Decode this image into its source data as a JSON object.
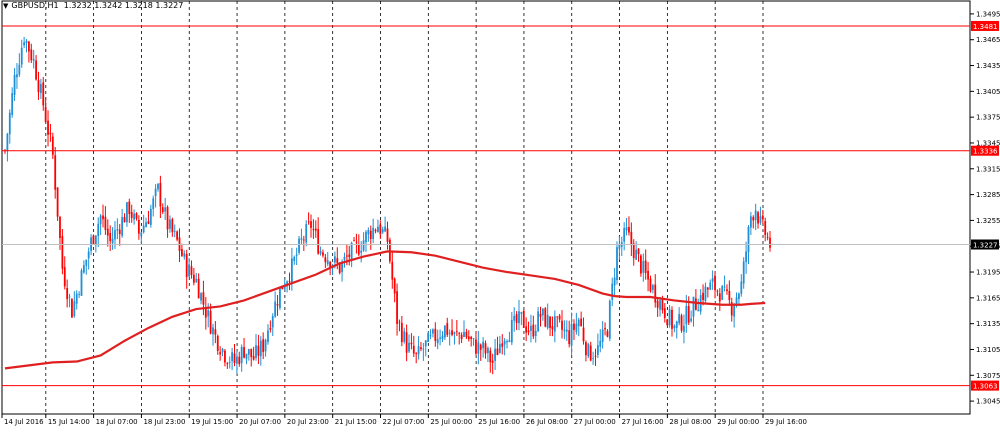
{
  "header": {
    "symbol": "GBPUSD,H1",
    "ohlc": "1.3232 1.3242 1.3218 1.3227",
    "menu_icon": "triangle-down-icon"
  },
  "chart_data": {
    "type": "candlestick",
    "symbol": "GBPUSD",
    "timeframe": "H1",
    "ylim": [
      1.303,
      1.351
    ],
    "y_ticks": [
      "1.3495",
      "1.3465",
      "1.3435",
      "1.3405",
      "1.3375",
      "1.3345",
      "1.3315",
      "1.3285",
      "1.3255",
      "1.3225",
      "1.3195",
      "1.3165",
      "1.3135",
      "1.3105",
      "1.3075",
      "1.3045"
    ],
    "x_ticks": [
      "14 Jul 2016",
      "15 Jul 14:00",
      "18 Jul 07:00",
      "18 Jul 23:00",
      "19 Jul 15:00",
      "20 Jul 07:00",
      "20 Jul 23:00",
      "21 Jul 15:00",
      "22 Jul 07:00",
      "25 Jul 00:00",
      "25 Jul 16:00",
      "26 Jul 08:00",
      "27 Jul 00:00",
      "27 Jul 16:00",
      "28 Jul 08:00",
      "29 Jul 00:00",
      "29 Jul 16:00"
    ],
    "horizontal_levels": [
      {
        "value": 1.3481,
        "label": "1.3481",
        "color": "#ff0000"
      },
      {
        "value": 1.3336,
        "label": "1.3336",
        "color": "#ff0000"
      },
      {
        "value": 1.3063,
        "label": "1.3063",
        "color": "#ff0000"
      }
    ],
    "current_price": {
      "value": 1.3227,
      "label": "1.3227"
    },
    "bull_color": "#1f8fd6",
    "bear_color": "#ff0000",
    "moving_average_color": "#e02020",
    "grid": "vertical-dashed",
    "close_path": [
      [
        0,
        1.3336
      ],
      [
        4,
        1.342
      ],
      [
        8,
        1.347
      ],
      [
        12,
        1.344
      ],
      [
        16,
        1.339
      ],
      [
        20,
        1.333
      ],
      [
        24,
        1.32
      ],
      [
        28,
        1.315
      ],
      [
        32,
        1.319
      ],
      [
        36,
        1.323
      ],
      [
        40,
        1.326
      ],
      [
        44,
        1.323
      ],
      [
        48,
        1.325
      ],
      [
        52,
        1.327
      ],
      [
        56,
        1.324
      ],
      [
        60,
        1.326
      ],
      [
        64,
        1.329
      ],
      [
        68,
        1.325
      ],
      [
        72,
        1.323
      ],
      [
        76,
        1.32
      ],
      [
        80,
        1.3185
      ],
      [
        84,
        1.315
      ],
      [
        88,
        1.312
      ],
      [
        92,
        1.31
      ],
      [
        96,
        1.309
      ],
      [
        100,
        1.3105
      ],
      [
        104,
        1.3095
      ],
      [
        108,
        1.311
      ],
      [
        112,
        1.315
      ],
      [
        116,
        1.318
      ],
      [
        120,
        1.32
      ],
      [
        124,
        1.323
      ],
      [
        128,
        1.325
      ],
      [
        132,
        1.322
      ],
      [
        136,
        1.321
      ],
      [
        140,
        1.32
      ],
      [
        144,
        1.3215
      ],
      [
        148,
        1.3225
      ],
      [
        152,
        1.324
      ],
      [
        156,
        1.325
      ],
      [
        160,
        1.3232
      ],
      [
        164,
        1.314
      ],
      [
        168,
        1.311
      ],
      [
        172,
        1.3095
      ],
      [
        176,
        1.311
      ],
      [
        180,
        1.312
      ],
      [
        184,
        1.313
      ],
      [
        188,
        1.312
      ],
      [
        192,
        1.3125
      ],
      [
        196,
        1.311
      ],
      [
        200,
        1.3105
      ],
      [
        204,
        1.309
      ],
      [
        208,
        1.312
      ],
      [
        212,
        1.313
      ],
      [
        216,
        1.314
      ],
      [
        220,
        1.3125
      ],
      [
        224,
        1.3145
      ],
      [
        228,
        1.3135
      ],
      [
        232,
        1.313
      ],
      [
        236,
        1.312
      ],
      [
        240,
        1.314
      ],
      [
        244,
        1.31
      ],
      [
        248,
        1.3105
      ],
      [
        252,
        1.313
      ],
      [
        256,
        1.322
      ],
      [
        260,
        1.324
      ],
      [
        264,
        1.3215
      ],
      [
        268,
        1.319
      ],
      [
        272,
        1.317
      ],
      [
        276,
        1.315
      ],
      [
        280,
        1.313
      ],
      [
        284,
        1.314
      ],
      [
        288,
        1.3155
      ],
      [
        292,
        1.317
      ],
      [
        296,
        1.318
      ],
      [
        300,
        1.317
      ],
      [
        304,
        1.3155
      ],
      [
        308,
        1.318
      ],
      [
        312,
        1.326
      ],
      [
        314,
        1.327
      ],
      [
        316,
        1.325
      ],
      [
        318,
        1.324
      ],
      [
        320,
        1.3227
      ]
    ],
    "ma_path": [
      [
        0,
        1.3083
      ],
      [
        20,
        1.309
      ],
      [
        30,
        1.3091
      ],
      [
        40,
        1.3098
      ],
      [
        50,
        1.3115
      ],
      [
        60,
        1.313
      ],
      [
        70,
        1.3143
      ],
      [
        80,
        1.3152
      ],
      [
        90,
        1.3155
      ],
      [
        100,
        1.3162
      ],
      [
        110,
        1.3172
      ],
      [
        120,
        1.3182
      ],
      [
        130,
        1.3192
      ],
      [
        140,
        1.3205
      ],
      [
        150,
        1.3213
      ],
      [
        160,
        1.3219
      ],
      [
        170,
        1.3218
      ],
      [
        180,
        1.3214
      ],
      [
        190,
        1.3207
      ],
      [
        200,
        1.32
      ],
      [
        210,
        1.3195
      ],
      [
        220,
        1.3191
      ],
      [
        230,
        1.3187
      ],
      [
        240,
        1.318
      ],
      [
        250,
        1.317
      ],
      [
        255,
        1.3167
      ],
      [
        260,
        1.3166
      ],
      [
        270,
        1.3166
      ],
      [
        280,
        1.3162
      ],
      [
        290,
        1.3159
      ],
      [
        300,
        1.3157
      ],
      [
        308,
        1.3157
      ],
      [
        312,
        1.3158
      ],
      [
        318,
        1.3159
      ]
    ]
  }
}
